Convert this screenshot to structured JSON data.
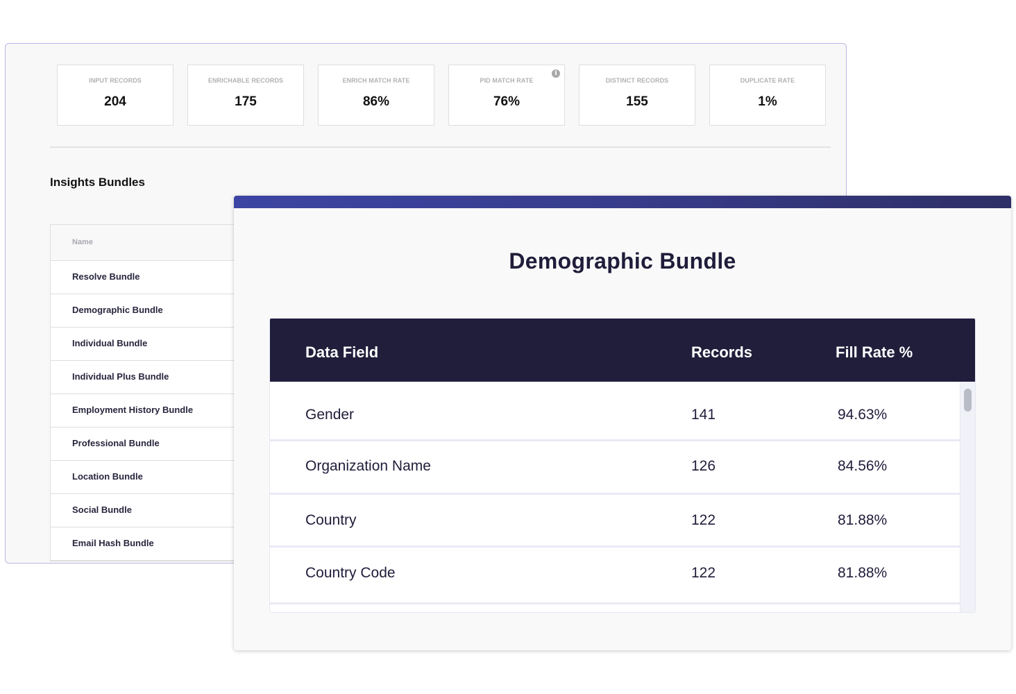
{
  "stats": [
    {
      "label": "INPUT RECORDS",
      "value": "204"
    },
    {
      "label": "ENRICHABLE RECORDS",
      "value": "175"
    },
    {
      "label": "ENRICH MATCH RATE",
      "value": "86%"
    },
    {
      "label": "PID MATCH RATE",
      "value": "76%",
      "info_icon": "i"
    },
    {
      "label": "DISTINCT RECORDS",
      "value": "155"
    },
    {
      "label": "DUPLICATE RATE",
      "value": "1%"
    }
  ],
  "insights": {
    "title": "Insights Bundles",
    "column_header": "Name",
    "bundles": [
      "Resolve Bundle",
      "Demographic Bundle",
      "Individual Bundle",
      "Individual Plus Bundle",
      "Employment History Bundle",
      "Professional Bundle",
      "Location Bundle",
      "Social Bundle",
      "Email Hash Bundle"
    ]
  },
  "modal": {
    "title": "Demographic Bundle",
    "columns": [
      "Data Field",
      "Records",
      "Fill Rate %"
    ],
    "rows": [
      {
        "field": "Gender",
        "records": "141",
        "fill_rate": "94.63%"
      },
      {
        "field": "Organization Name",
        "records": "126",
        "fill_rate": "84.56%"
      },
      {
        "field": "Country",
        "records": "122",
        "fill_rate": "81.88%"
      },
      {
        "field": "Country Code",
        "records": "122",
        "fill_rate": "81.88%"
      }
    ]
  },
  "colors": {
    "accent_bar": "#3c45a3",
    "table_header": "#201e3b",
    "panel_border": "#b9b6e6"
  }
}
